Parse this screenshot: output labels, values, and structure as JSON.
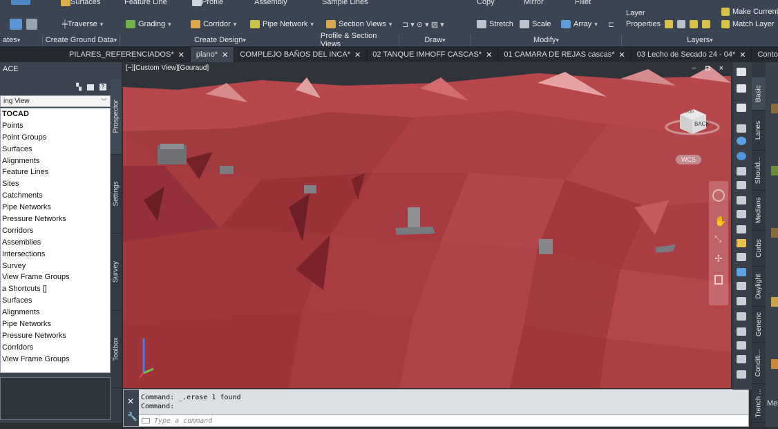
{
  "ribbon": {
    "row1": [
      "Surfaces",
      "Feature Line",
      "Profile",
      "Assembly",
      "Sample Lines",
      "Copy",
      "Mirror",
      "Fillet"
    ],
    "row2": {
      "traverse": "Traverse",
      "grading": "Grading",
      "corridor": "Corridor",
      "pipe_network": "Pipe Network",
      "section_views": "Section Views",
      "stretch": "Stretch",
      "scale": "Scale",
      "array": "Array",
      "properties": "Properties",
      "match_layer": "Match Layer",
      "layer": "Layer",
      "make_current": "Make Current"
    },
    "panels": {
      "ates": "ates",
      "create_ground_data": "Create Ground Data",
      "create_design": "Create Design",
      "profile_section_views": "Profile & Section Views",
      "draw": "Draw",
      "modify": "Modify",
      "layers": "Layers"
    }
  },
  "tabs": [
    "PILARES_REFERENCIADOS*",
    "plano*",
    "COMPLEJO BAÑOS DEL INCA*",
    "02 TANQUE IMHOFF CASCAS*",
    "01 CAMARA DE REJAS cascas*",
    "03 Lecho de Secado 24 - 04*",
    "Contour*"
  ],
  "toolspace": {
    "title": "ACE",
    "view_select": "ing View",
    "tree": [
      "TOCAD",
      "Points",
      "Point Groups",
      "Surfaces",
      "Alignments",
      "Feature Lines",
      "Sites",
      "Catchments",
      "Pipe Networks",
      "Pressure Networks",
      "Corridors",
      "Assemblies",
      "Intersections",
      "Survey",
      "View Frame Groups",
      "a Shortcuts []",
      "Surfaces",
      "Alignments",
      "Pipe Networks",
      "Pressure Networks",
      "Corridors",
      "View Frame Groups"
    ],
    "vtabs": [
      "Prospector",
      "Settings",
      "Survey",
      "Toolbox"
    ]
  },
  "viewport": {
    "label": "[−][Custom View][Gouraud]",
    "window_controls": "− ◘ ×",
    "viewcube_top": "TOP",
    "viewcube_face": "BACK",
    "wcs": "WCS",
    "terrain_color": "#a83b40"
  },
  "command": {
    "line1": "Command: _.erase 1 found",
    "line2": "Command:",
    "placeholder": "Type a command"
  },
  "palettes": {
    "tabs": [
      "Basic",
      "Lanes",
      "Should...",
      "Medians",
      "Curbs",
      "Daylight",
      "Generic",
      "Conditi...",
      "Trench ..."
    ],
    "edge_label": "Me"
  }
}
